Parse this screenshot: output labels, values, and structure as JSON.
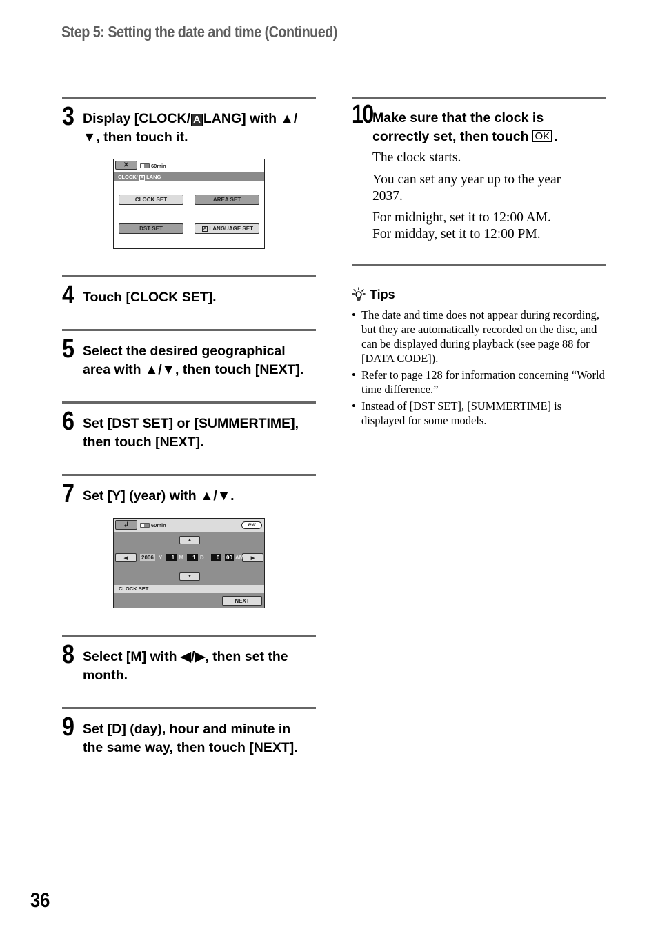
{
  "header": {
    "title": "Step 5: Setting the date and time (Continued)"
  },
  "steps": [
    {
      "number": "3",
      "lines": [
        "Display [CLOCK/ Ⓐ LANG] with ▲/",
        "▼, then touch it."
      ]
    },
    {
      "number": "4",
      "lines": [
        "Touch [CLOCK SET]."
      ]
    },
    {
      "number": "5",
      "lines": [
        "Select the desired geographical",
        "area with ▲/▼, then touch [NEXT]."
      ]
    },
    {
      "number": "6",
      "lines": [
        "Set [DST SET] or [SUMMERTIME],",
        "then touch [NEXT]."
      ]
    },
    {
      "number": "7",
      "lines": [
        "Set [Y] (year) with ▲/▼."
      ]
    },
    {
      "number": "8",
      "lines": [
        "Select [M] with ◀/▶, then set the",
        "month."
      ]
    },
    {
      "number": "9",
      "lines": [
        "Set [D] (day), hour and minute in",
        "the same way, then touch [NEXT]."
      ]
    },
    {
      "number": "10",
      "lines": [
        "Make sure that the clock is",
        "correctly set, then touch"
      ],
      "ok_label": "OK",
      "end_punct": "."
    }
  ],
  "step3_line1_pre": "Display [CLOCK/",
  "step3_line1_a": "A",
  "step3_line1_post": "LANG] with ▲/",
  "step10_body": [
    "The clock starts.",
    "You can set any year up to the year",
    "2037.",
    "For midnight, set it to 12:00 AM.",
    "For midday, set it to 12:00 PM."
  ],
  "tips": {
    "title": "Tips",
    "items": [
      "The date and time does not appear during recording, but they are automatically recorded on the disc, and can be displayed during playback (see page 88 for [DATA CODE]).",
      "Refer to page 128 for information concerning “World time difference.”",
      "Instead of [DST SET], [SUMMERTIME] is displayed for some models."
    ]
  },
  "screen_clock_lang": {
    "close_icon": "✕",
    "battery_label": "60min",
    "title_pre": "CLOCK/",
    "title_a": "A",
    "title_post": "LANG",
    "buttons": [
      "CLOCK SET",
      "AREA SET",
      "DST SET",
      "LANGUAGE SET"
    ]
  },
  "screen_clock_set": {
    "return_icon": "⮌",
    "battery_label": "60min",
    "disc_label": "RW",
    "up": "▲",
    "down": "▼",
    "left": "◀",
    "right": "▶",
    "year": "2006",
    "year_unit": "Y",
    "month": "1",
    "month_unit": "M",
    "day": "1",
    "day_unit": "D",
    "hour": "0",
    "colon": ":",
    "minute": "00",
    "ampm": "AM",
    "title": "CLOCK SET",
    "next_label": "NEXT"
  },
  "page_number": "36"
}
